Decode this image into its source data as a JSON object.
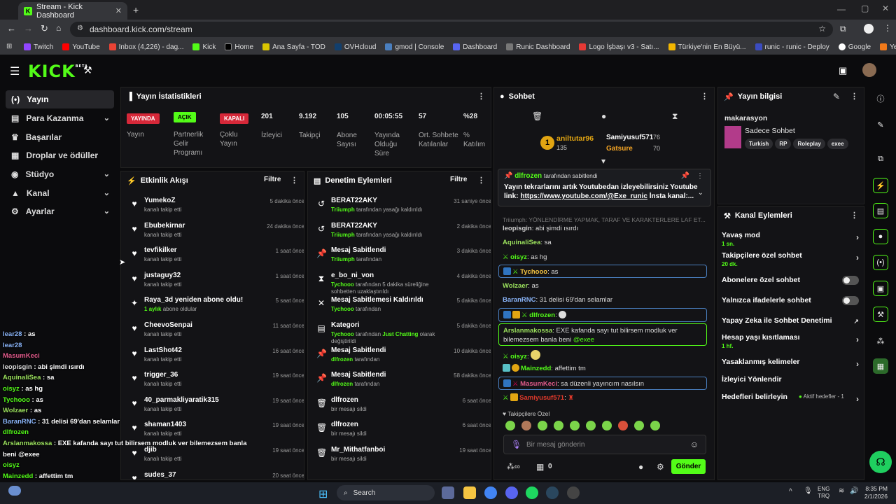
{
  "browser": {
    "tab_title": "Stream - Kick Dashboard",
    "url": "dashboard.kick.com/stream",
    "bookmarks": [
      "Twitch",
      "YouTube",
      "Inbox (4,226) - dag...",
      "Kick",
      "Home",
      "Ana Sayfa - TOD",
      "OVHcloud",
      "gmod | Console",
      "Dashboard",
      "Runic Dashboard",
      "Logo İşbaşı v3 - Satı...",
      "Türkiye'nin En Büyü...",
      "runic - runic - Deploy",
      "Google",
      "Yemek - Trendyol Go"
    ]
  },
  "app": {
    "logo": "KICK",
    "beta": "BETA"
  },
  "sidebar": {
    "items": [
      {
        "label": "Yayın"
      },
      {
        "label": "Para Kazanma"
      },
      {
        "label": "Başarılar"
      },
      {
        "label": "Droplar ve ödüller"
      },
      {
        "label": "Stüdyo"
      },
      {
        "label": "Kanal"
      },
      {
        "label": "Ayarlar"
      }
    ]
  },
  "stats": {
    "title": "Yayın İstatistikleri",
    "badges": [
      {
        "badge": "YAYINDA",
        "label": "Yayın"
      },
      {
        "badge": "AÇIK",
        "label": "Partnerlik Gelir Programı"
      },
      {
        "badge": "KAPALI",
        "label": "Çoklu Yayın"
      }
    ],
    "numbers": [
      {
        "value": "201",
        "label": "İzleyici"
      },
      {
        "value": "9.192",
        "label": "Takipçi"
      },
      {
        "value": "105",
        "label": "Abone Sayısı"
      },
      {
        "value": "00:05:55",
        "label": "Yayında Olduğu Süre"
      },
      {
        "value": "57",
        "label": "Ort. Sohbete Katılanlar"
      },
      {
        "value": "%28",
        "label": "% Katılım"
      }
    ]
  },
  "activity": {
    "title": "Etkinlik Akışı",
    "filter": "Filtre",
    "items": [
      {
        "name": "YumekoZ",
        "sub": "kanalı takip etti",
        "time": "5 dakika önce"
      },
      {
        "name": "Ebubekirnar",
        "sub": "kanalı takip etti",
        "time": "24 dakika önce"
      },
      {
        "name": "tevfikilker",
        "sub": "kanalı takip etti",
        "time": "1 saat önce"
      },
      {
        "name": "justaguy32",
        "sub": "kanalı takip etti",
        "time": "1 saat önce"
      },
      {
        "name": "Raya_3d yeniden abone oldu!",
        "sub_g": "1 aylık",
        "sub": "abone oldular",
        "time": "5 saat önce"
      },
      {
        "name": "CheevoSenpai",
        "sub": "kanalı takip etti",
        "time": "11 saat önce"
      },
      {
        "name": "LastShot42",
        "sub": "kanalı takip etti",
        "time": "16 saat önce"
      },
      {
        "name": "trigger_36",
        "sub": "kanalı takip etti",
        "time": "19 saat önce"
      },
      {
        "name": "40_parmakliyaratik315",
        "sub": "kanalı takip etti",
        "time": "19 saat önce"
      },
      {
        "name": "shaman1403",
        "sub": "kanalı takip etti",
        "time": "19 saat önce"
      },
      {
        "name": "djib",
        "sub": "kanalı takip etti",
        "time": "19 saat önce"
      },
      {
        "name": "sudes_37",
        "sub": "",
        "time": "20 saat önce"
      }
    ]
  },
  "moderation": {
    "title": "Denetim Eylemleri",
    "filter": "Filtre",
    "items": [
      {
        "icon": "↺",
        "name": "BERAT22AKY",
        "g": "Triiumph",
        "sub": "tarafından yasağı kaldırıldı",
        "time": "31 saniye önce"
      },
      {
        "icon": "↺",
        "name": "BERAT22AKY",
        "g": "Triiumph",
        "sub": "tarafından yasağı kaldırıldı",
        "time": "2 dakika önce"
      },
      {
        "icon": "📌",
        "name": "Mesaj Sabitlendi",
        "g": "Triiumph",
        "sub": "tarafından",
        "time": "3 dakika önce"
      },
      {
        "icon": "⧗",
        "name": "e_bo_ni_von",
        "g": "Tychooo",
        "sub": "tarafından 5 dakika süreliğine sohbetten uzaklaştırıldı",
        "time": "4 dakika önce"
      },
      {
        "icon": "✕",
        "name": "Mesaj Sabitlemesi Kaldırıldı",
        "g": "Tychooo",
        "sub": "tarafından",
        "time": "5 dakika önce"
      },
      {
        "icon": "▤",
        "name": "Kategori",
        "g": "Tychooo",
        "sub": "tarafından",
        "g2": "Just Chatting",
        "sub2": "olarak değiştirildi",
        "time": "5 dakika önce"
      },
      {
        "icon": "📌",
        "name": "Mesaj Sabitlendi",
        "g": "dlfrozen",
        "sub": "tarafından",
        "time": "10 dakika önce"
      },
      {
        "icon": "📌",
        "name": "Mesaj Sabitlendi",
        "g": "dlfrozen",
        "sub": "tarafından",
        "time": "58 dakika önce"
      },
      {
        "icon": "🗑",
        "name": "dlfrozen",
        "sub": "bir mesajı sildi",
        "time": "6 saat önce"
      },
      {
        "icon": "🗑",
        "name": "dlfrozen",
        "sub": "bir mesajı sildi",
        "time": "6 saat önce"
      },
      {
        "icon": "🗑",
        "name": "Mr_Mithatfanboi",
        "sub": "bir mesajı sildi",
        "time": "19 saat önce"
      }
    ]
  },
  "chat": {
    "title": "Sohbet",
    "gifters": [
      {
        "name": "aniltutar96",
        "count": "135"
      },
      {
        "name": "Samiyusuf571",
        "count": "76"
      },
      {
        "name": "Gatsure",
        "count": "70"
      }
    ],
    "pinned": {
      "by": "dlfrozen",
      "by_suffix": "tarafından sabitlendi",
      "text": "Yayın tekrarlarını artık Youtubedan izleyebilirsiniz Youtube link:",
      "link": "https://www.youtube.com/@Exe_runic",
      "tail": "İnsta kanal:..."
    },
    "faded": "Triiumph: YÖNLENDİRME YAPMAK, TARAF VE KARAKTERLERE LAF ET...",
    "messages": [
      {
        "user": "leopisgin",
        "text": "abi şimdi ısırdı",
        "color": "#cfcfcf"
      },
      {
        "user": "AquinaliSea",
        "text": "sa",
        "color": "#9be15d"
      },
      {
        "user": "oisyz",
        "text": "as hg",
        "color": "#53fc18"
      },
      {
        "user": "Tychooo",
        "text": "as",
        "color": "#f5c542"
      },
      {
        "user": "Wolzaer",
        "text": "as",
        "color": "#9be15d"
      },
      {
        "user": "BaranRNC",
        "text": "31 delisi 69'dan selamlar",
        "color": "#8ab4f8"
      },
      {
        "user": "dlfrozen",
        "text": "",
        "color": "#53fc18"
      },
      {
        "user": "Arslanmakossa",
        "text": "EXE kafanda sayı tut bilirsem modluk ver bilemezsem banla beni",
        "mention": "@exee",
        "color": "#9be15d"
      },
      {
        "user": "oisyz",
        "text": "",
        "color": "#53fc18"
      },
      {
        "user": "Mainzedd",
        "text": "affettim tm",
        "color": "#53fc18"
      },
      {
        "user": "MasumKeci",
        "text": "sa düzenli yayıncım nasılsın",
        "color": "#e05a8a"
      },
      {
        "user": "Samiyusuf571",
        "text": "",
        "color": "#e0392b"
      }
    ],
    "emote_section": "Takipçilere Özel",
    "input_placeholder": "Bir mesaj gönderin",
    "count": "0",
    "send": "Gönder"
  },
  "overlay": [
    {
      "user": "lear28",
      "text": "as"
    },
    {
      "user": "lear28",
      "text": ""
    },
    {
      "user": "MasumKeci",
      "text": ""
    },
    {
      "user": "leopisgin",
      "text": "abi şimdi ısırdı"
    },
    {
      "user": "AquinaliSea",
      "text": "sa"
    },
    {
      "user": "oisyz",
      "text": "as hg"
    },
    {
      "user": "Tychooo",
      "text": "as"
    },
    {
      "user": "Wolzaer",
      "text": "as"
    },
    {
      "user": "BaranRNC",
      "text": "31 delisi 69'dan selamlar"
    },
    {
      "user": "dlfrozen",
      "text": ""
    },
    {
      "user": "Arslanmakossa",
      "text": "EXE kafanda sayı tut bilirsem modluk ver bilemezsem banla"
    },
    {
      "user": "",
      "text": "beni @exee"
    },
    {
      "user": "oisyz",
      "text": ""
    },
    {
      "user": "Mainzedd",
      "text": "affettim tm"
    },
    {
      "user": "MasumKeci",
      "text": "sa düzenli yayıncım nasılsın"
    }
  ],
  "stream_info": {
    "title": "Yayın bilgisi",
    "stream_title": "makarasyon",
    "category": "Sadece Sohbet",
    "tags": [
      "Turkish",
      "RP",
      "Roleplay",
      "exee"
    ]
  },
  "channel_actions": {
    "title": "Kanal Eylemleri",
    "items": [
      {
        "label": "Yavaş mod",
        "sub": "1 sn.",
        "kind": "arrow"
      },
      {
        "label": "Takipçilere özel sohbet",
        "sub": "20 dk.",
        "kind": "arrow"
      },
      {
        "label": "Abonelere özel sohbet",
        "sub": "",
        "kind": "toggle"
      },
      {
        "label": "Yalnızca ifadelerle sohbet",
        "sub": "",
        "kind": "toggle"
      },
      {
        "label": "Yapay Zeka ile Sohbet Denetimi",
        "sub": "",
        "kind": "ext"
      },
      {
        "label": "Hesap yaşı kısıtlaması",
        "sub": "1 hf.",
        "kind": "arrow"
      },
      {
        "label": "Yasaklanmış kelimeler",
        "sub": "",
        "kind": "arrow"
      },
      {
        "label": "İzleyici Yönlendir",
        "sub": "",
        "kind": "none"
      },
      {
        "label": "Hedefleri belirleyin",
        "sub": "",
        "kind": "goal",
        "goal": "Aktif hedefler - 1"
      }
    ]
  },
  "taskbar": {
    "search": "Search",
    "lang1": "ENG",
    "lang2": "TRQ",
    "time": "8:35 PM",
    "date": "2/1/2026"
  }
}
